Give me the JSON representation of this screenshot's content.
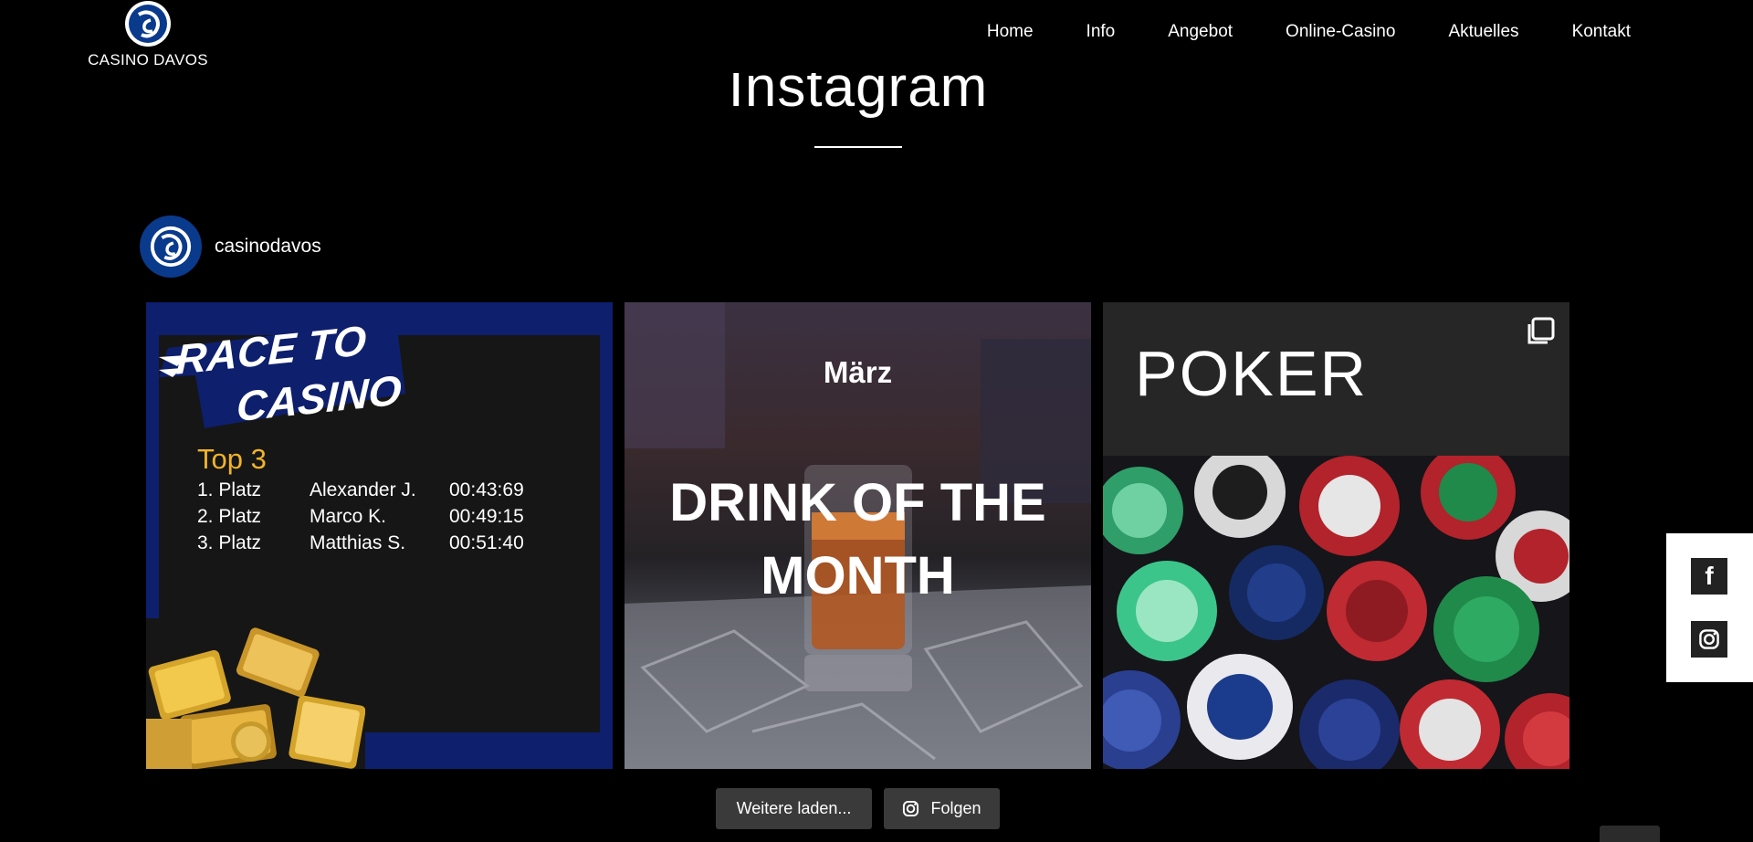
{
  "header": {
    "logo_text": "CASINO DAVOS",
    "nav": [
      "Home",
      "Info",
      "Angebot",
      "Online-Casino",
      "Aktuelles",
      "Kontakt"
    ]
  },
  "section": {
    "title": "Instagram"
  },
  "profile": {
    "username": "casinodavos"
  },
  "posts": [
    {
      "headline_line1": "RACE TO",
      "headline_line2": "CASINO",
      "top_label": "Top 3",
      "ranking": [
        {
          "place": "1. Platz",
          "name": "Alexander J.",
          "time": "00:43:69"
        },
        {
          "place": "2. Platz",
          "name": "Marco K.",
          "time": "00:49:15"
        },
        {
          "place": "3. Platz",
          "name": "Matthias S.",
          "time": "00:51:40"
        }
      ]
    },
    {
      "month": "März",
      "headline": "DRINK OF THE MONTH"
    },
    {
      "headline": "POKER",
      "icon": "carousel-icon"
    }
  ],
  "buttons": {
    "load_more": "Weitere laden...",
    "follow": "Folgen"
  },
  "social": {
    "facebook_icon": "facebook-icon",
    "instagram_icon": "instagram-icon"
  },
  "colors": {
    "background": "#000000",
    "brand_blue": "#0e1f6e",
    "gold": "#f0b429",
    "button_bg": "#3a3a3a"
  }
}
